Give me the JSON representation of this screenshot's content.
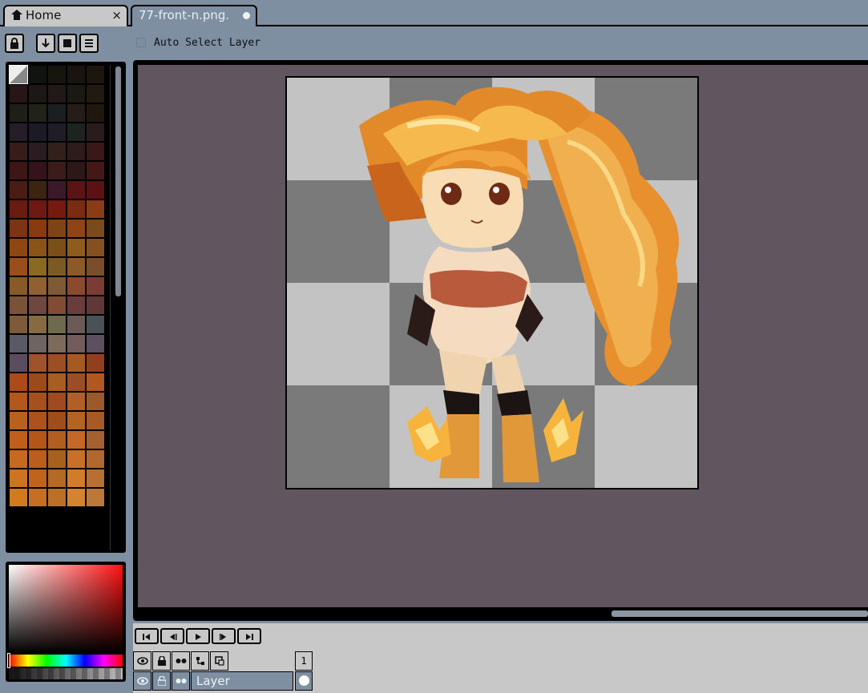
{
  "tabs": {
    "home_label": "Home",
    "home_close": "×",
    "file_label": "77-front-n.png."
  },
  "toolbar": {
    "buttons": [
      {
        "icon": "lock-icon",
        "glyph": "🔒"
      },
      {
        "icon": "arrow-down-icon",
        "glyph": "↓"
      },
      {
        "icon": "square-icon",
        "glyph": "■"
      },
      {
        "icon": "menu-icon",
        "glyph": "☰"
      }
    ],
    "auto_select_label": "Auto Select Layer",
    "auto_select_checked": false
  },
  "palette": {
    "colors": [
      "#9a9a9a",
      "#0f1410",
      "#18150f",
      "#1a1410",
      "#1c160e",
      "#281616",
      "#1d1716",
      "#231818",
      "#1a1a13",
      "#201a10",
      "#1e2018",
      "#22211a",
      "#1a1f1f",
      "#261c1a",
      "#20180f",
      "#251d28",
      "#1c1a26",
      "#201c28",
      "#1d2320",
      "#2a1c1c",
      "#381c1c",
      "#2a1c20",
      "#32201a",
      "#2e1c1c",
      "#3a1818",
      "#3f1616",
      "#34141a",
      "#3b1c18",
      "#2c1818",
      "#451818",
      "#4a1d14",
      "#3c2410",
      "#3a1a28",
      "#5a1414",
      "#5c1214",
      "#6a1c10",
      "#6e1a14",
      "#761a10",
      "#7a2c12",
      "#8c3c14",
      "#7c3414",
      "#8a3a10",
      "#7e4416",
      "#8e4414",
      "#7a4a1c",
      "#8c4810",
      "#8a5418",
      "#7c4e18",
      "#8e5c1c",
      "#845020",
      "#9a4e1c",
      "#8a6a22",
      "#7c5a26",
      "#8a5a28",
      "#7a4e2c",
      "#885a2a",
      "#906032",
      "#7e5a36",
      "#8a4a2e",
      "#7a3c34",
      "#7a5238",
      "#6e4840",
      "#824c34",
      "#6a3c3c",
      "#603838",
      "#7c5a3a",
      "#866a44",
      "#6e6a4e",
      "#6c5a58",
      "#4a5258",
      "#5a5a66",
      "#6e6462",
      "#7c6a5a",
      "#725c5c",
      "#5c5060",
      "#5c4c60",
      "#a0522a",
      "#9c4e24",
      "#a45a20",
      "#943e20",
      "#ac4a1c",
      "#9c4a1a",
      "#a85e22",
      "#9a4e26",
      "#b05820",
      "#b2581a",
      "#a6501c",
      "#a04a22",
      "#b06026",
      "#9c5a2a",
      "#b8601e",
      "#ac521c",
      "#9e4e1c",
      "#b46422",
      "#a85a26",
      "#c05e1c",
      "#b45618",
      "#b25e20",
      "#c4682a",
      "#a46030",
      "#c66a22",
      "#ba5e1e",
      "#a8601e",
      "#c87028",
      "#b0682e",
      "#cc7420",
      "#c0641c",
      "#b26a24",
      "#d07c2a",
      "#b87032",
      "#d27a1e",
      "#c66e22",
      "#bc7026",
      "#d48430",
      "#bc7838"
    ]
  },
  "layers": {
    "frame_number": "1",
    "layer_name": "Layer"
  }
}
